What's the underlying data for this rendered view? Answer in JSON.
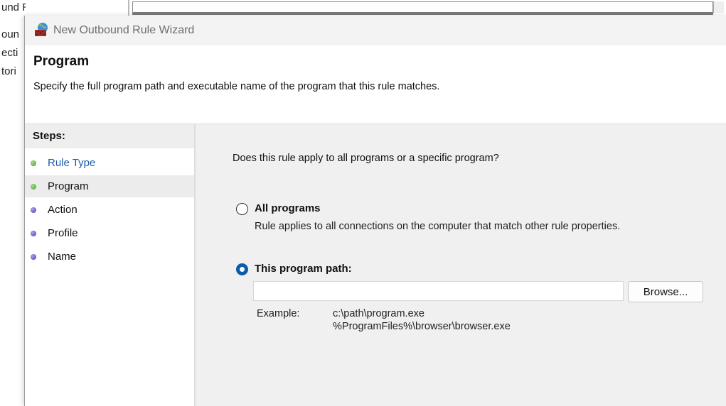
{
  "background": {
    "tree_items": [
      "und Rules",
      "oun",
      "ecti",
      "tori"
    ]
  },
  "window": {
    "title": "New Outbound Rule Wizard",
    "app_icon": "firewall-icon"
  },
  "header": {
    "title": "Program",
    "description": "Specify the full program path and executable name of the program that this rule matches."
  },
  "steps": {
    "title": "Steps:",
    "items": [
      {
        "label": "Rule Type",
        "status": "done",
        "link": true
      },
      {
        "label": "Program",
        "status": "done",
        "selected": true
      },
      {
        "label": "Action",
        "status": "todo"
      },
      {
        "label": "Profile",
        "status": "todo"
      },
      {
        "label": "Name",
        "status": "todo"
      }
    ]
  },
  "content": {
    "question": "Does this rule apply to all programs or a specific program?",
    "all_programs": {
      "label": "All programs",
      "description": "Rule applies to all connections on the computer that match other rule properties.",
      "selected": false
    },
    "program_path": {
      "label": "This program path:",
      "selected": true,
      "value": "",
      "browse_label": "Browse..."
    },
    "example": {
      "label": "Example:",
      "lines": [
        "c:\\path\\program.exe",
        "%ProgramFiles%\\browser\\browser.exe"
      ]
    }
  },
  "colors": {
    "accent": "#0b5cab",
    "link": "#1a5ca8",
    "step_done": "#3f9b2f",
    "step_todo": "#4636b8",
    "content_bg": "#f0f0f0"
  }
}
